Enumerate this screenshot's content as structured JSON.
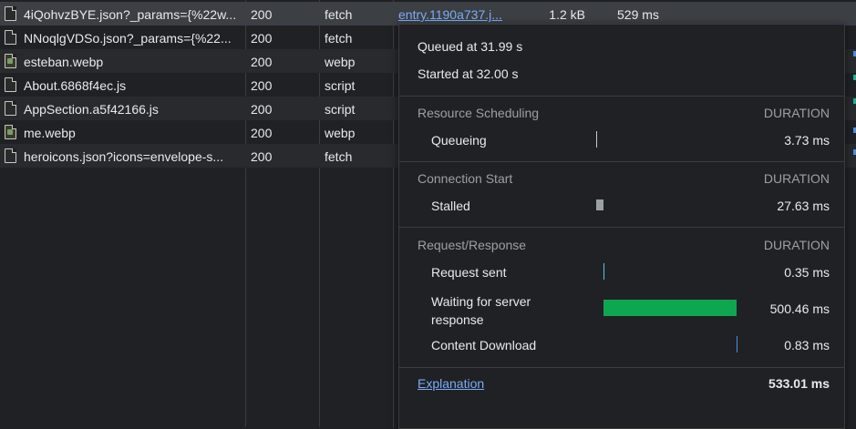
{
  "requests": [
    {
      "name": "4iQohvzBYE.json?_params={%22w...",
      "status": "200",
      "type": "fetch",
      "initiator": "entry.1190a737.j...",
      "size": "1.2 kB",
      "time": "529 ms",
      "icon": "file-icon"
    },
    {
      "name": "NNoqlgVDSo.json?_params={%22...",
      "status": "200",
      "type": "fetch",
      "icon": "file-icon"
    },
    {
      "name": "esteban.webp",
      "status": "200",
      "type": "webp",
      "icon": "image-file-icon"
    },
    {
      "name": "About.6868f4ec.js",
      "status": "200",
      "type": "script",
      "icon": "file-icon"
    },
    {
      "name": "AppSection.a5f42166.js",
      "status": "200",
      "type": "script",
      "icon": "file-icon"
    },
    {
      "name": "me.webp",
      "status": "200",
      "type": "webp",
      "icon": "image-file-icon"
    },
    {
      "name": "heroicons.json?icons=envelope-s...",
      "status": "200",
      "type": "fetch",
      "icon": "file-icon"
    }
  ],
  "timing": {
    "queued": "Queued at 31.99 s",
    "started": "Started at 32.00 s",
    "sections": [
      {
        "title": "Resource Scheduling",
        "dur_label": "DURATION",
        "rows": [
          {
            "label": "Queueing",
            "duration": "3.73 ms",
            "ms": 3.73
          }
        ]
      },
      {
        "title": "Connection Start",
        "dur_label": "DURATION",
        "rows": [
          {
            "label": "Stalled",
            "duration": "27.63 ms",
            "ms": 27.63
          }
        ]
      },
      {
        "title": "Request/Response",
        "dur_label": "DURATION",
        "rows": [
          {
            "label": "Request sent",
            "duration": "0.35 ms",
            "ms": 0.35
          },
          {
            "label": "Waiting for server response",
            "duration": "500.46 ms",
            "ms": 500.46
          },
          {
            "label": "Content Download",
            "duration": "0.83 ms",
            "ms": 0.83
          }
        ]
      }
    ],
    "explanation": "Explanation",
    "total": "533.01 ms",
    "colors": {
      "queueing": "#9aa0a6",
      "stalled": "#9aa0a6",
      "request_sent": "#4fc3f7",
      "waiting": "#0fa650",
      "download": "#4a90e2"
    }
  }
}
